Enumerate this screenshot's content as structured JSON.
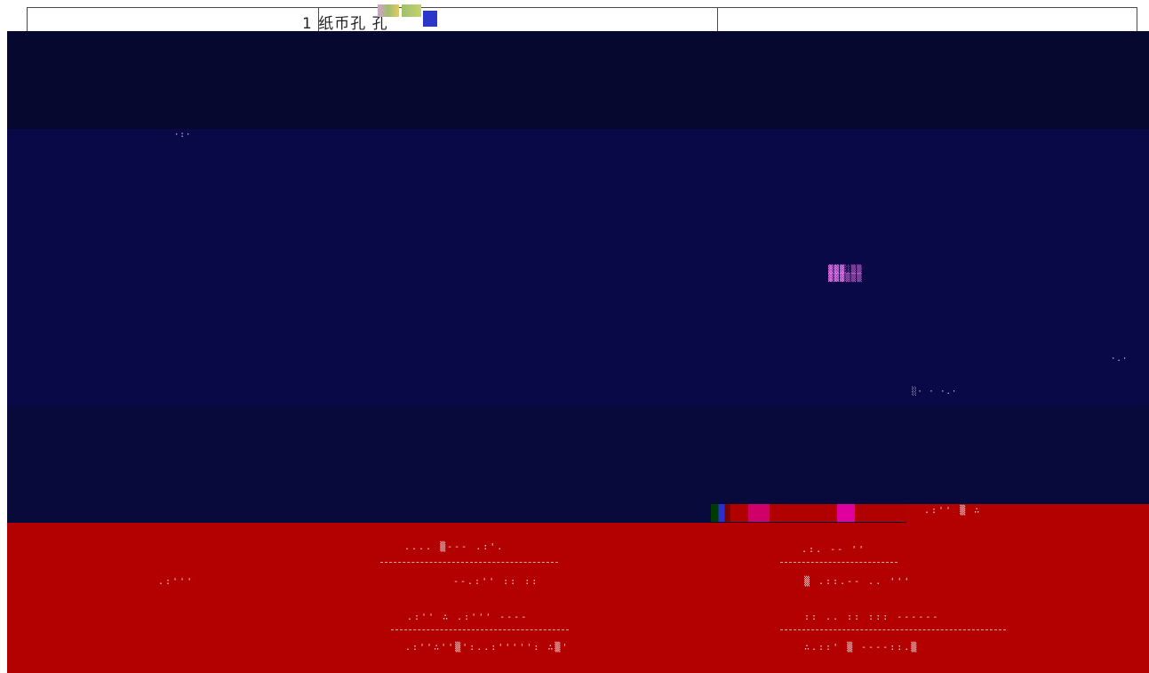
{
  "table": {
    "cell_text": "1 纸币孔 孔"
  },
  "icons": {
    "glitch_noise": "glitch-noise",
    "dotted_text": "dotted-artifact"
  }
}
